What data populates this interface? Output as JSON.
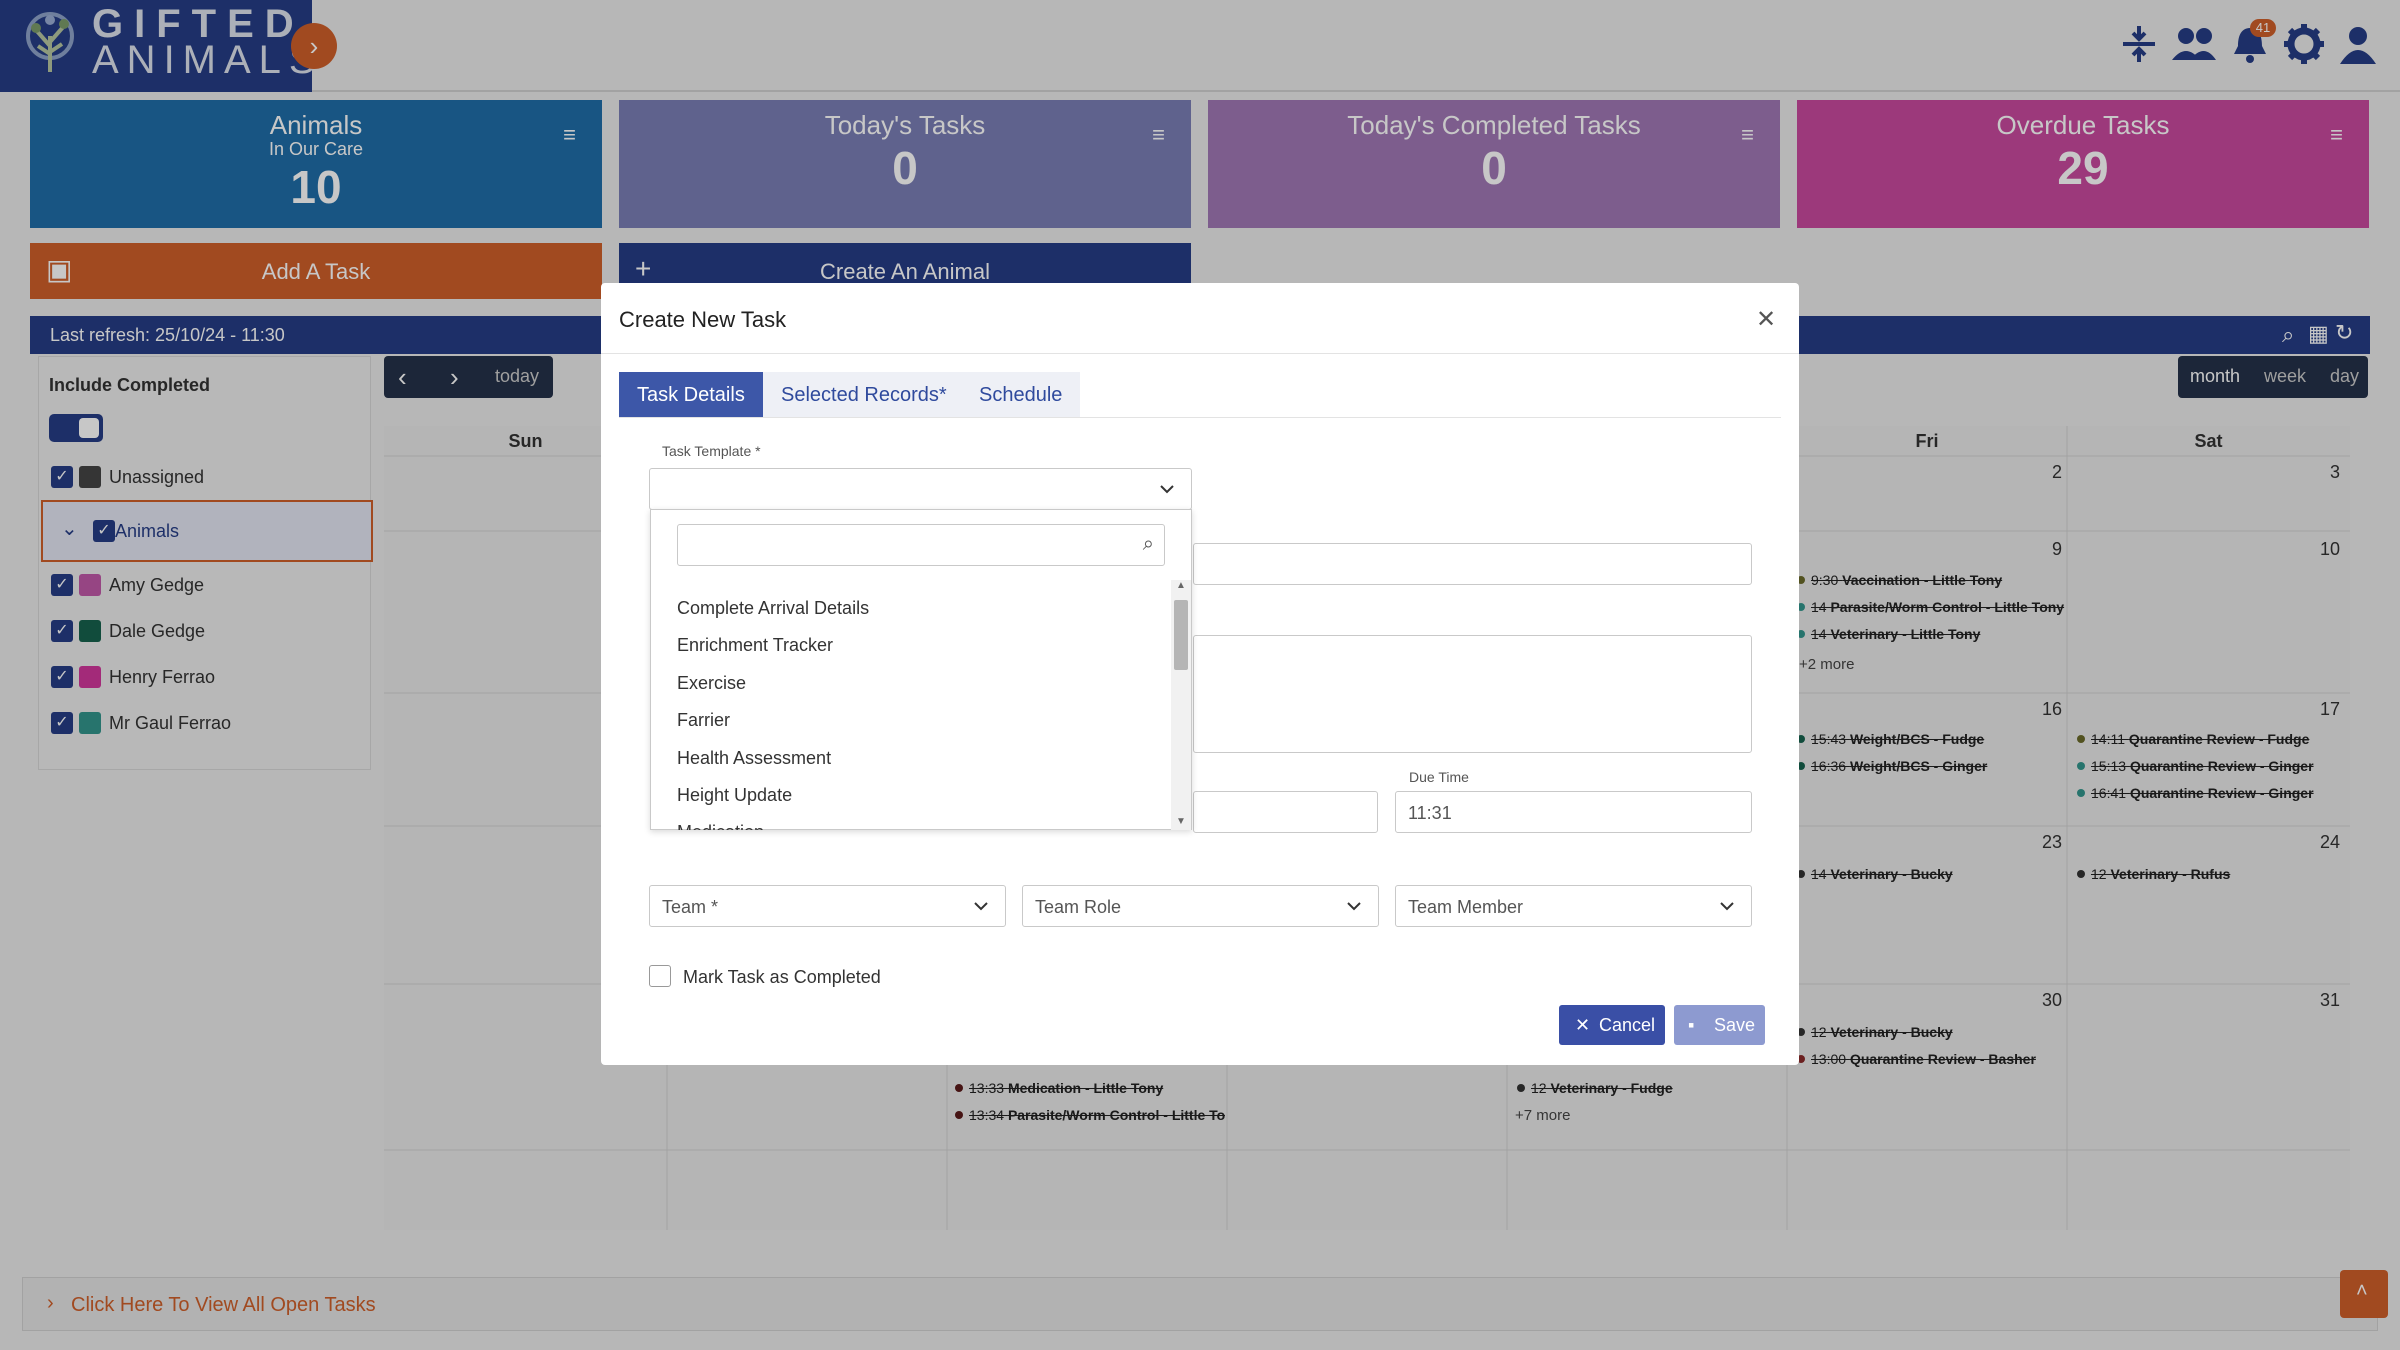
{
  "header": {
    "logo_line1": "GIFTED",
    "logo_line2": "ANIMALS",
    "notification_count": "41"
  },
  "stats": [
    {
      "title": "Animals",
      "subtitle": "In Our Care",
      "value": "10",
      "color": "#1f6ea8"
    },
    {
      "title": "Today's Tasks",
      "subtitle": "",
      "value": "0",
      "color": "#7a7eb5"
    },
    {
      "title": "Today's Completed Tasks",
      "subtitle": "",
      "value": "0",
      "color": "#a078b5"
    },
    {
      "title": "Overdue Tasks",
      "subtitle": "",
      "value": "29",
      "color": "#c84a9e"
    }
  ],
  "actions": {
    "add_task": "Add A Task",
    "create_animal": "Create An Animal"
  },
  "calendar_bar": {
    "last_refresh": "Last refresh: 25/10/24 - 11:30"
  },
  "left_panel": {
    "include_completed": "Include Completed",
    "unassigned": "Unassigned",
    "animals": "Animals",
    "people": [
      {
        "name": "Amy Gedge",
        "color": "#c159a8"
      },
      {
        "name": "Dale Gedge",
        "color": "#17624e"
      },
      {
        "name": "Henry Ferrao",
        "color": "#d1379b"
      },
      {
        "name": "Mr Gaul Ferrao",
        "color": "#32958c"
      }
    ]
  },
  "calendar": {
    "today": "today",
    "views": [
      "month",
      "week",
      "day"
    ],
    "days": {
      "sun": "Sun",
      "fri": "Fri",
      "sat": "Sat"
    },
    "numbers": {
      "fri_w1": "2",
      "sat_w1": "3",
      "fri_w2": "9",
      "sat_w2": "10",
      "fri_w3": "16",
      "sat_w3": "17",
      "fri_w4": "23",
      "sat_w4": "24",
      "fri_w5": "30",
      "sat_w5": "31"
    },
    "events": {
      "fri_w2": [
        {
          "time": "9:30",
          "label": "Vaccination - Little Tony",
          "color": "#6a6a2a"
        },
        {
          "time": "14",
          "label": "Parasite/Worm Control - Little Tony",
          "color": "#32958c"
        },
        {
          "time": "14",
          "label": "Veterinary - Little Tony",
          "color": "#32958c"
        }
      ],
      "fri_w2_more": "+2 more",
      "fri_w3": [
        {
          "time": "15:43",
          "label": "Weight/BCS - Fudge",
          "color": "#17624e"
        },
        {
          "time": "16:36",
          "label": "Weight/BCS - Ginger",
          "color": "#17624e"
        }
      ],
      "sat_w3": [
        {
          "time": "14:11",
          "label": "Quarantine Review - Fudge",
          "color": "#6a6a2a"
        },
        {
          "time": "15:13",
          "label": "Quarantine Review - Ginger",
          "color": "#32958c"
        },
        {
          "time": "16:41",
          "label": "Quarantine Review - Ginger",
          "color": "#32958c"
        }
      ],
      "fri_w4": [
        {
          "time": "14",
          "label": "Veterinary - Bucky",
          "color": "#333333"
        }
      ],
      "sat_w4": [
        {
          "time": "12",
          "label": "Veterinary - Rufus",
          "color": "#333333"
        }
      ],
      "fri_w5": [
        {
          "time": "12",
          "label": "Veterinary - Bucky",
          "color": "#333333"
        },
        {
          "time": "13:00",
          "label": "Quarantine Review - Basher",
          "color": "#8a2a2a"
        }
      ],
      "wed_w5": [
        {
          "time": "13:33",
          "label": "Medication - Little Tony",
          "color": "#5a1a1a"
        },
        {
          "time": "13:34",
          "label": "Parasite/Worm Control - Little Tony",
          "color": "#5a1a1a"
        }
      ],
      "thu_w5": [
        {
          "time": "12",
          "label": "Veterinary - Fudge",
          "color": "#333333"
        }
      ],
      "thu_w5_more": "+7 more"
    }
  },
  "modal": {
    "title": "Create New Task",
    "tabs": [
      "Task Details",
      "Selected Records*",
      "Schedule"
    ],
    "task_template_label": "Task Template *",
    "due_time_label": "Due Time",
    "due_time_value": "11:31",
    "team_placeholder": "Team *",
    "team_role_placeholder": "Team Role",
    "team_member_placeholder": "Team Member",
    "mark_completed": "Mark Task as Completed",
    "cancel": "Cancel",
    "save": "Save",
    "template_options": [
      "Complete Arrival Details",
      "Enrichment Tracker",
      "Exercise",
      "Farrier",
      "Health Assessment",
      "Height Update",
      "Medication"
    ]
  },
  "footer": {
    "open_tasks": "Click Here To View All Open Tasks"
  }
}
